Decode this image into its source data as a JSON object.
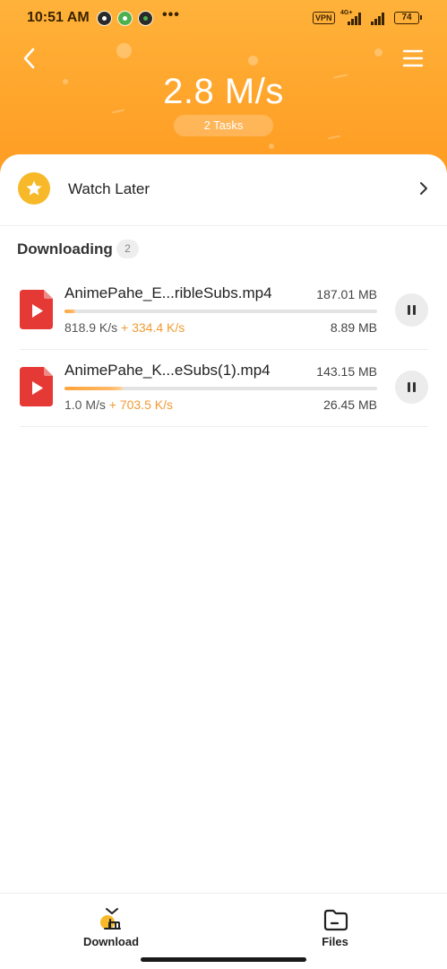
{
  "status_bar": {
    "time": "10:51 AM",
    "more": "•••",
    "vpn": "VPN",
    "network": "4G+",
    "battery": "74"
  },
  "header": {
    "speed": "2.8 M/s",
    "tasks_label": "2 Tasks",
    "back_icon": "chevron-left-icon",
    "menu_icon": "hamburger-menu-icon"
  },
  "watch_later": {
    "label": "Watch Later",
    "icon": "star-icon"
  },
  "downloading": {
    "title": "Downloading",
    "count": "2",
    "tasks": [
      {
        "name": "AnimePahe_E...ribleSubs.mp4",
        "total_size": "187.01 MB",
        "speed": "818.9 K/s",
        "boost": "+ 334.4 K/s",
        "downloaded": "8.89 MB",
        "progress": 0.035
      },
      {
        "name": "AnimePahe_K...eSubs(1).mp4",
        "total_size": "143.15 MB",
        "speed": "1.0 M/s",
        "boost": "+ 703.5 K/s",
        "downloaded": "26.45 MB",
        "progress": 0.185
      }
    ]
  },
  "bottom_nav": {
    "download_label": "Download",
    "files_label": "Files"
  },
  "colors": {
    "header_orange": "#ffa52c",
    "accent_orange": "#f29a33",
    "file_icon_red": "#e53935",
    "star_yellow": "#f7b92a"
  }
}
